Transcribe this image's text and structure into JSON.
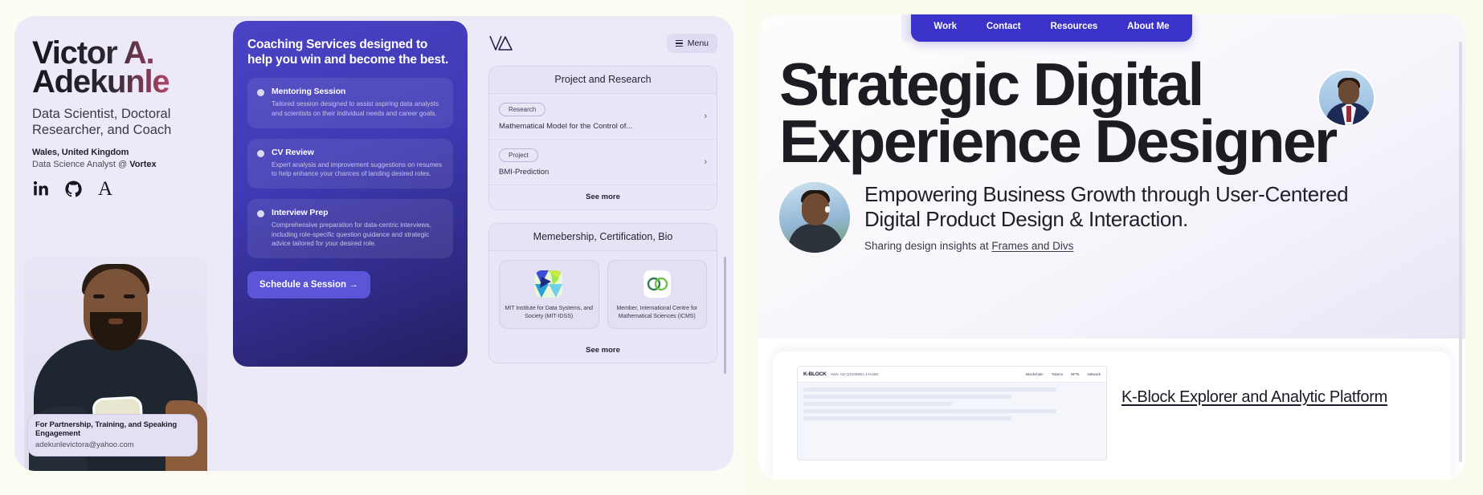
{
  "left": {
    "identity": {
      "name_line1": "Victor A.",
      "name_line2": "Adekunle",
      "role": "Data Scientist, Doctoral Researcher, and Coach",
      "location": "Wales, United Kingdom",
      "company_prefix": "Data Science Analyst @ ",
      "company_name": "Vortex",
      "socials": [
        {
          "name": "linkedin-icon",
          "label": "in"
        },
        {
          "name": "github-icon",
          "label": "GitHub"
        },
        {
          "name": "medium-icon",
          "label": "A"
        }
      ],
      "contact": {
        "title": "For Partnership, Training, and Speaking Engagement",
        "email": "adekunlevictora@yahoo.com"
      }
    },
    "coaching": {
      "title": "Coaching Services designed to help you win and become the best.",
      "services": [
        {
          "title": "Mentoring Session",
          "desc": "Tailored session designed to assist aspiring data analysts and scientists on their individual needs and career goals."
        },
        {
          "title": "CV Review",
          "desc": "Expert analysis and improvement suggestions on resumes to help enhance your chances of landing desired roles."
        },
        {
          "title": "Interview Prep",
          "desc": "Comprehensive preparation for data-centric interviews, including role-specific question guidance and strategic advice tailored for your desired role."
        }
      ],
      "cta": "Schedule a Session →"
    },
    "projects": {
      "menu_label": "Menu",
      "panel_title": "Project and Research",
      "items": [
        {
          "chip": "Research",
          "name": "Mathematical Model for the Control of..."
        },
        {
          "chip": "Project",
          "name": "BMI-Prediction"
        }
      ],
      "see_more": "See more"
    },
    "memberships": {
      "panel_title": "Memebership, Certification, Bio",
      "items": [
        {
          "caption": "MIT Institute for Data Systems, and Society (MIT-IDSS)"
        },
        {
          "caption": "Member, International Centre for Mathematical Sciences (ICMS)"
        }
      ],
      "see_more": "See more"
    }
  },
  "right": {
    "nav": [
      {
        "label": "Work"
      },
      {
        "label": "Contact"
      },
      {
        "label": "Resources"
      },
      {
        "label": "About Me"
      }
    ],
    "headline_line1": "Strategic Digital",
    "headline_line2": "Experience Designer",
    "subhead_line1": "Empowering Business Growth through User-Centered",
    "subhead_line2": "Digital Product Design & Interaction.",
    "sharing_prefix": "Sharing design insights at ",
    "sharing_link": "Frames and Divs",
    "work": {
      "title": "K-Block Explorer and Analytic Platform",
      "mock_logo": "K-BLOCK",
      "mock_sub": "AWS: KB-Q420B8B1-4-KUBE",
      "mock_nav": [
        "Blockchain",
        "Tokens",
        "NFTs",
        "Network"
      ]
    }
  },
  "colors": {
    "accent_purple": "#3b32c9",
    "coaching_gradient_start": "#4a43c4",
    "coaching_gradient_end": "#231f5e",
    "name_gradient_end": "#e0688d",
    "left_bg": "#eceaf8"
  }
}
